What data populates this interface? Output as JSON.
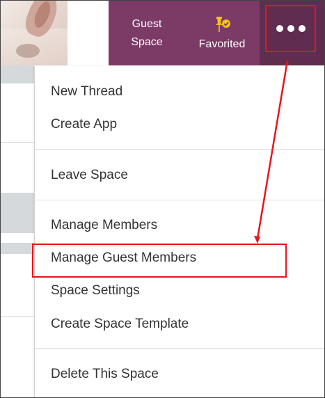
{
  "header": {
    "guest_space_line1": "Guest",
    "guest_space_line2": "Space",
    "favorited_label": "Favorited",
    "more_icon": "more-horizontal-icon",
    "pin_icon": "pin-check-icon"
  },
  "menu": {
    "group1": [
      "New Thread",
      "Create App"
    ],
    "group2": [
      "Leave Space"
    ],
    "group3": [
      "Manage Members",
      "Manage Guest Members",
      "Space Settings",
      "Create Space Template"
    ],
    "group4": [
      "Delete This Space"
    ]
  },
  "colors": {
    "header_bar": "#7c3a66",
    "more_button": "#5e2d4f",
    "annotation_red": "#e8141b",
    "pin_yellow": "#f2c21a",
    "menu_text": "#333333"
  }
}
